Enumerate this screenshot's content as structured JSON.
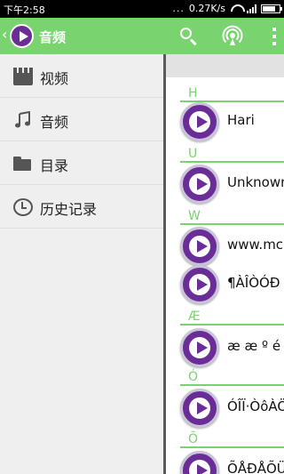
{
  "status_bar": {
    "time": "下午2:58",
    "dots": "...",
    "speed": "0.27K/s",
    "battery_level": 0.8
  },
  "header": {
    "title": "音频",
    "icons": [
      "back-chevron-icon",
      "app-logo-icon",
      "search-icon",
      "cast-icon",
      "more-vert-icon"
    ]
  },
  "sidebar": {
    "items": [
      {
        "label": "视频",
        "icon": "film-icon"
      },
      {
        "label": "音频",
        "icon": "music-note-icon"
      },
      {
        "label": "目录",
        "icon": "folder-icon"
      },
      {
        "label": "历史记录",
        "icon": "history-clock-icon"
      }
    ]
  },
  "list": {
    "sections": [
      {
        "letter": "H",
        "items": [
          "Hari"
        ]
      },
      {
        "letter": "U",
        "items": [
          "Unknown"
        ]
      },
      {
        "letter": "W",
        "items": [
          "www.mc",
          "¶ÀÎÒÓÐ"
        ]
      },
      {
        "letter": "Æ",
        "items": [
          "æ  æ º é"
        ]
      },
      {
        "letter": "Ó",
        "items": [
          "ÓÎÏ·ÒôÀÖ"
        ]
      },
      {
        "letter": "Õ",
        "items": [
          "ÕÅÐÅÕÜ"
        ]
      }
    ]
  },
  "colors": {
    "accent_green": "#79d36f",
    "play_purple": "#6a2d98",
    "status_bar": "#000000"
  }
}
